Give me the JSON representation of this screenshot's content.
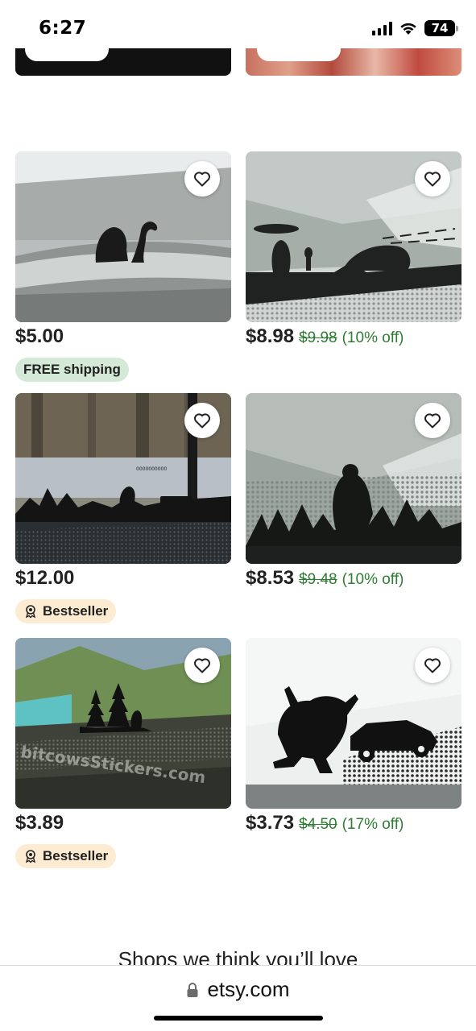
{
  "status_bar": {
    "time": "6:27",
    "battery": "74"
  },
  "products": [
    {
      "id": "p1",
      "price": "$5.00",
      "original_price": "",
      "discount": "",
      "badge": "FREE shipping",
      "badge_type": "shipping",
      "favorite_icon": "heart-outline-icon"
    },
    {
      "id": "p2",
      "price": "$8.98",
      "original_price": "$9.98",
      "discount": "(10% off)",
      "badge": "",
      "badge_type": "",
      "favorite_icon": "heart-outline-icon"
    },
    {
      "id": "p3",
      "price": "$12.00",
      "original_price": "",
      "discount": "",
      "badge": "Bestseller",
      "badge_type": "bestseller",
      "favorite_icon": "heart-outline-icon"
    },
    {
      "id": "p4",
      "price": "$8.53",
      "original_price": "$9.48",
      "discount": "(10% off)",
      "badge": "",
      "badge_type": "",
      "favorite_icon": "heart-outline-icon"
    },
    {
      "id": "p5",
      "price": "$3.89",
      "original_price": "",
      "discount": "",
      "badge": "Bestseller",
      "badge_type": "bestseller",
      "favorite_icon": "heart-outline-icon"
    },
    {
      "id": "p6",
      "price": "$3.73",
      "original_price": "$4.50",
      "discount": "(17% off)",
      "badge": "",
      "badge_type": "",
      "favorite_icon": "heart-outline-icon"
    }
  ],
  "image_watermarks": {
    "p5": "bitcowsStickers.com"
  },
  "section_heading": "Shops we think you’ll love",
  "url_bar": {
    "url": "etsy.com"
  },
  "colors": {
    "sale_green": "#2e7d32",
    "shipping_badge_bg": "#d4e9d7",
    "bestseller_badge_bg": "#fdebd2"
  }
}
